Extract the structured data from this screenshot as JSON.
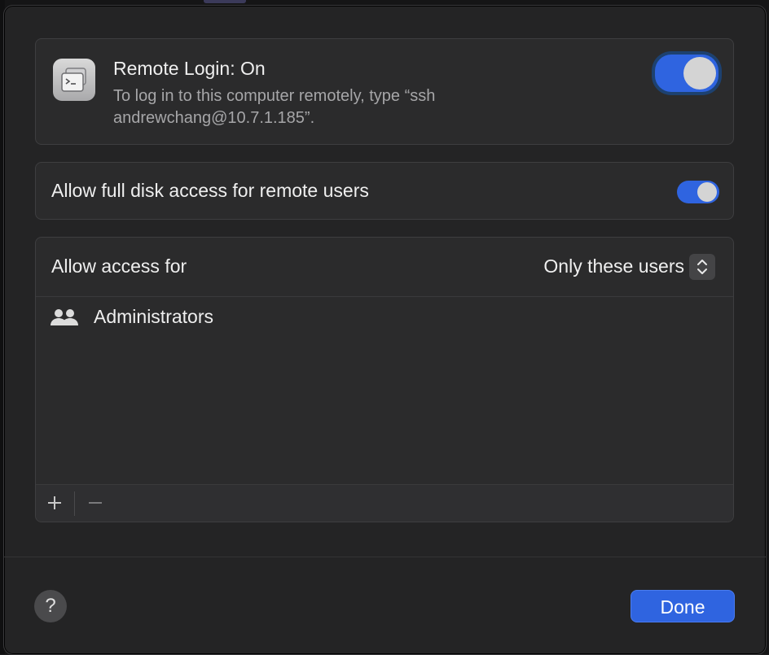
{
  "remote_login": {
    "title": "Remote Login: On",
    "description": "To log in to this computer remotely, type “ssh andrewchang@10.7.1.185”.",
    "toggle_state": "on",
    "icon": "terminal-screens-icon"
  },
  "disk_access": {
    "label": "Allow full disk access for remote users",
    "toggle_state": "on"
  },
  "access": {
    "label": "Allow access for",
    "selected_option": "Only these users",
    "users": [
      {
        "icon": "group-icon",
        "name": "Administrators"
      }
    ],
    "add_label": "+",
    "remove_label": "−"
  },
  "footer": {
    "help_label": "?",
    "done_label": "Done"
  },
  "colors": {
    "accent": "#2f64e0",
    "sheet_bg": "#242425",
    "card_bg": "#2b2b2c",
    "text_primary": "#efefef",
    "text_secondary": "#a6a6a8"
  }
}
